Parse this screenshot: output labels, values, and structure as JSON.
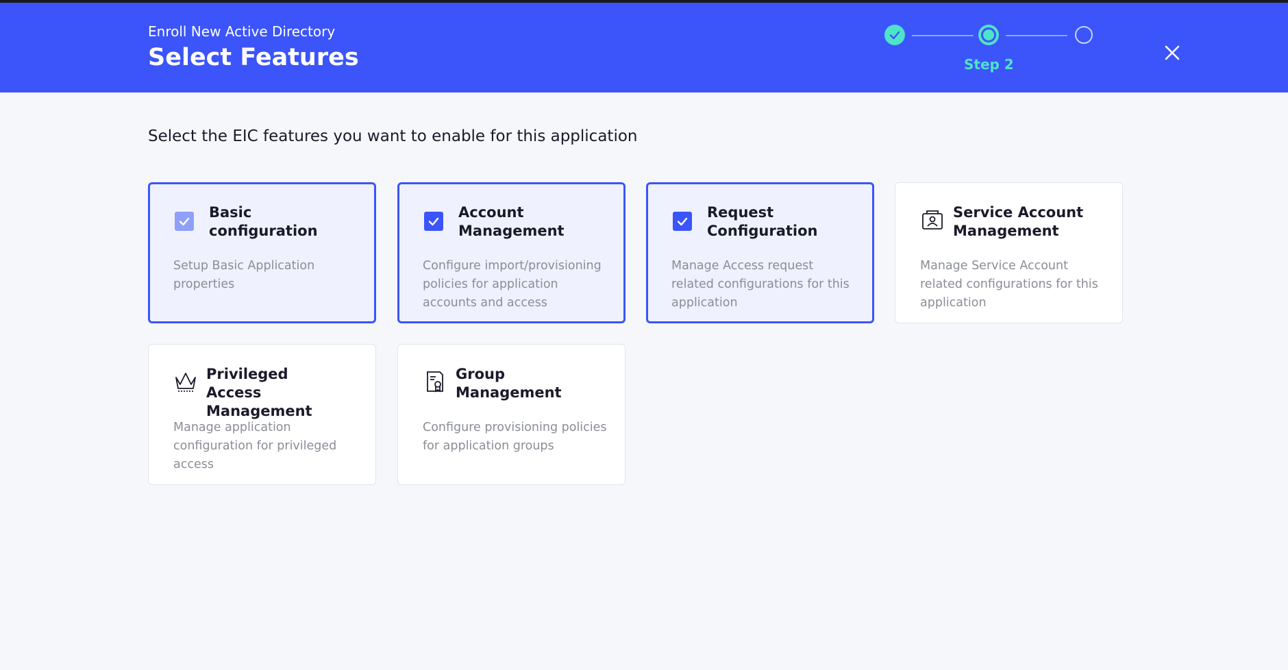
{
  "header": {
    "subtitle": "Enroll New Active Directory",
    "title": "Select Features",
    "step_label": "Step 2",
    "accent_color": "#3b55fa",
    "step_color": "#4fe3c8"
  },
  "main": {
    "instruction": "Select the EIC features you want to enable for this application",
    "features": [
      {
        "title": "Basic configuration",
        "description": "Setup Basic Application properties",
        "selected": true,
        "icon": "checkbox-checked-icon"
      },
      {
        "title": "Account Management",
        "description": "Configure import/provisioning policies for application accounts and access",
        "selected": true,
        "icon": "checkbox-checked-icon"
      },
      {
        "title": "Request Configuration",
        "description": "Manage Access request related configurations for this application",
        "selected": true,
        "icon": "checkbox-checked-icon"
      },
      {
        "title": "Service Account Management",
        "description": "Manage Service Account related configurations for this application",
        "selected": false,
        "icon": "service-account-icon"
      },
      {
        "title": "Privileged Access Management",
        "description": "Manage application configuration for privileged access",
        "selected": false,
        "icon": "crown-icon"
      },
      {
        "title": "Group Management",
        "description": "Configure provisioning policies for application groups",
        "selected": false,
        "icon": "certificate-icon"
      }
    ]
  }
}
